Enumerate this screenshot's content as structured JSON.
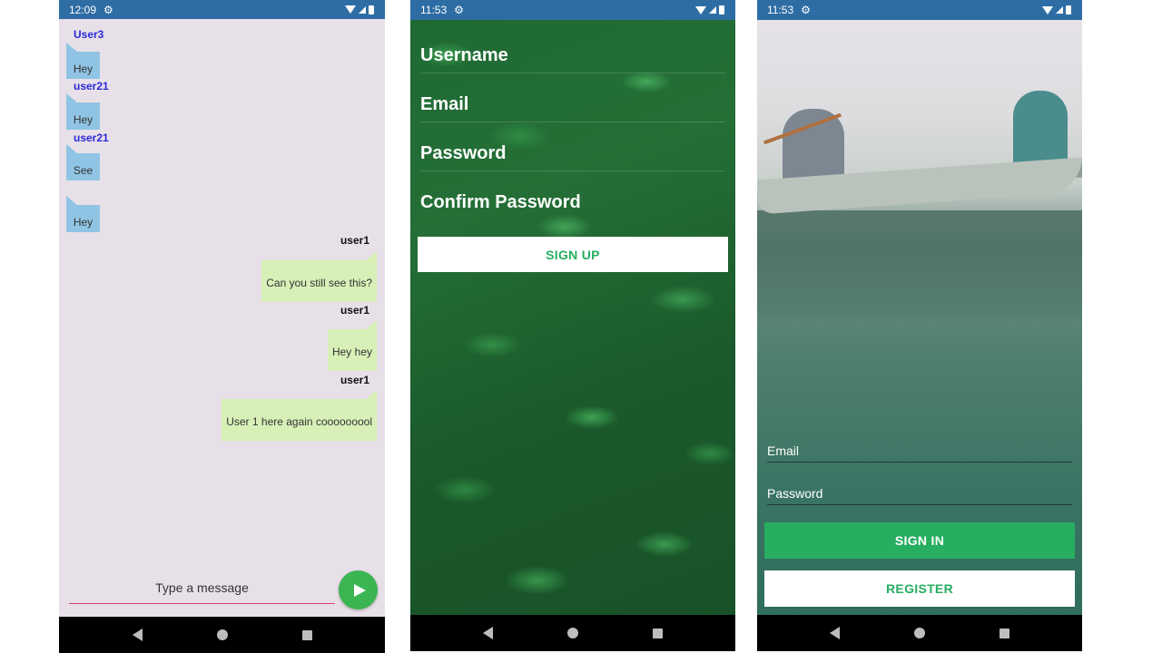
{
  "chat_screen": {
    "status_time": "12:09",
    "incoming": [
      {
        "user": "User3",
        "text": "Hey"
      },
      {
        "user": "user21",
        "text": "Hey"
      },
      {
        "user": "user21",
        "text": "See"
      },
      {
        "user": "",
        "text": "Hey"
      }
    ],
    "outgoing": [
      {
        "user": "user1",
        "text": "Can you still see this?"
      },
      {
        "user": "user1",
        "text": "Hey hey"
      },
      {
        "user": "user1",
        "text": "User 1 here again cooooooool"
      }
    ],
    "input_placeholder": "Type a message",
    "send_icon": "send-icon"
  },
  "signup_screen": {
    "status_time": "11:53",
    "fields": [
      "Username",
      "Email",
      "Password",
      "Confirm Password"
    ],
    "signup_label": "SIGN UP"
  },
  "signin_screen": {
    "status_time": "11:53",
    "email_label": "Email",
    "password_label": "Password",
    "signin_label": "SIGN IN",
    "register_label": "REGISTER"
  },
  "colors": {
    "status_bar": "#2e6da4",
    "accent_green": "#27ae60",
    "incoming_bubble": "#90c4e4",
    "outgoing_bubble": "#d7f0b8",
    "send_button": "#3bb552"
  }
}
